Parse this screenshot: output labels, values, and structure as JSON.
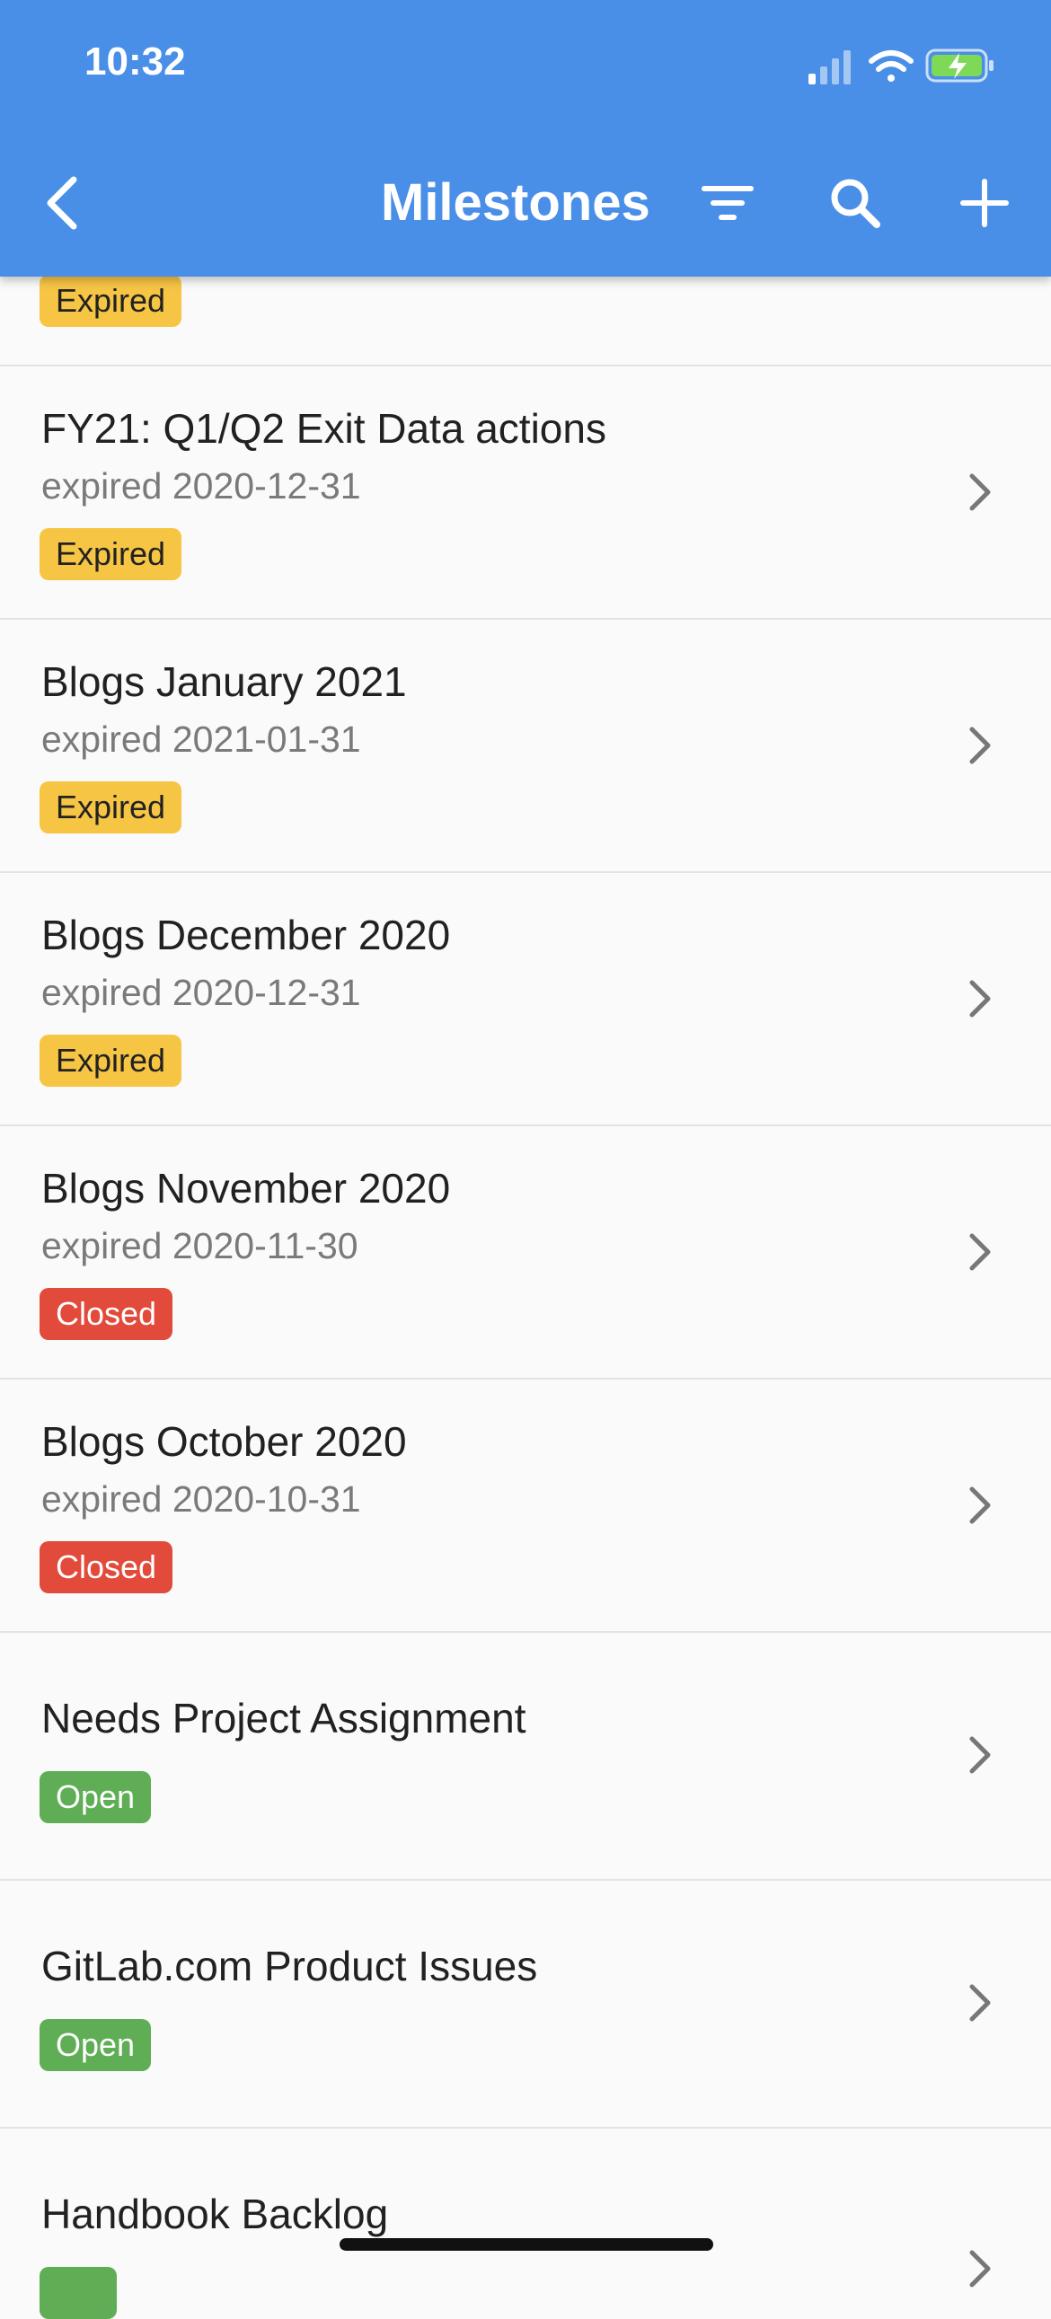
{
  "status_bar": {
    "time": "10:32"
  },
  "header": {
    "title": "Milestones"
  },
  "milestones": [
    {
      "title": "",
      "subtitle": "",
      "badge": "Expired",
      "state": "expired"
    },
    {
      "title": "FY21: Q1/Q2 Exit Data actions",
      "subtitle": "expired 2020-12-31",
      "badge": "Expired",
      "state": "expired"
    },
    {
      "title": "Blogs January 2021",
      "subtitle": "expired 2021-01-31",
      "badge": "Expired",
      "state": "expired"
    },
    {
      "title": "Blogs December 2020",
      "subtitle": "expired 2020-12-31",
      "badge": "Expired",
      "state": "expired"
    },
    {
      "title": "Blogs November 2020",
      "subtitle": "expired 2020-11-30",
      "badge": "Closed",
      "state": "closed"
    },
    {
      "title": "Blogs October 2020",
      "subtitle": "expired 2020-10-31",
      "badge": "Closed",
      "state": "closed"
    },
    {
      "title": "Needs Project Assignment",
      "subtitle": "",
      "badge": "Open",
      "state": "open"
    },
    {
      "title": "GitLab.com Product Issues",
      "subtitle": "",
      "badge": "Open",
      "state": "open"
    },
    {
      "title": "Handbook Backlog",
      "subtitle": "",
      "badge": "",
      "state": "open"
    }
  ],
  "colors": {
    "appbar": "#4a8fe7",
    "expired": "#f7c544",
    "closed": "#e24a3b",
    "open": "#5fae55"
  },
  "icons": [
    "back-icon",
    "filter-icon",
    "search-icon",
    "add-icon",
    "chevron-right-icon",
    "signal-icon",
    "wifi-icon",
    "battery-charging-icon"
  ]
}
